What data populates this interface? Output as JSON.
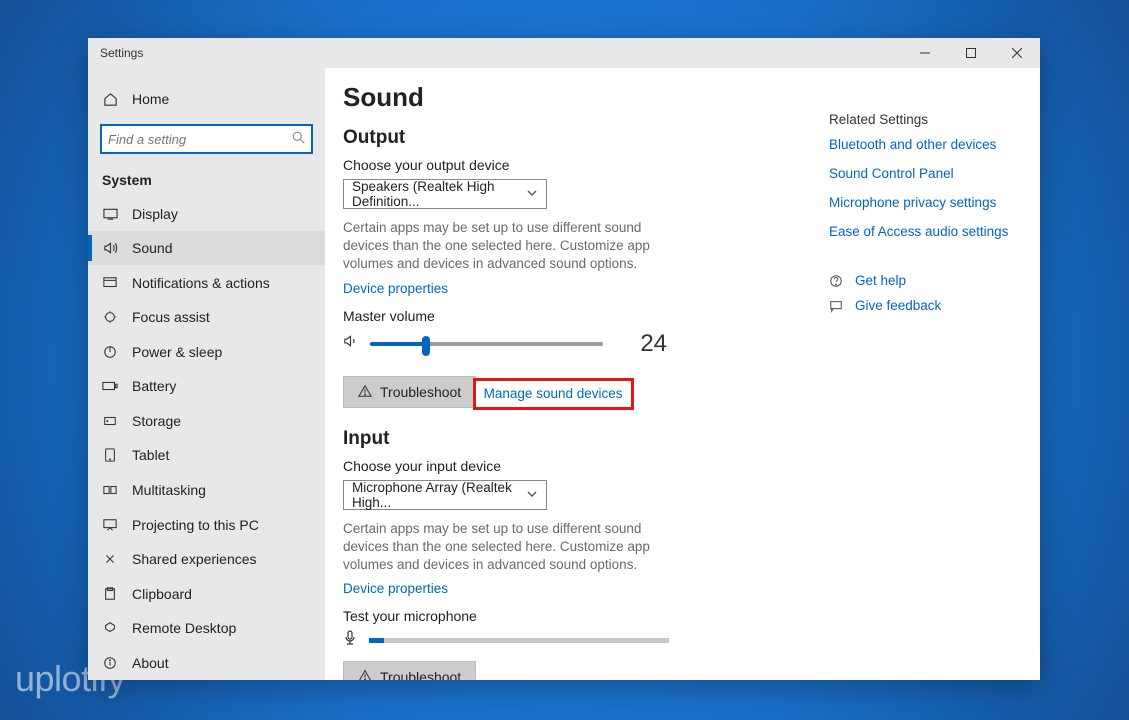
{
  "watermark": "uplotify",
  "window": {
    "title": "Settings"
  },
  "sidebar": {
    "home": "Home",
    "search_placeholder": "Find a setting",
    "heading": "System",
    "items": [
      {
        "label": "Display"
      },
      {
        "label": "Sound"
      },
      {
        "label": "Notifications & actions"
      },
      {
        "label": "Focus assist"
      },
      {
        "label": "Power & sleep"
      },
      {
        "label": "Battery"
      },
      {
        "label": "Storage"
      },
      {
        "label": "Tablet"
      },
      {
        "label": "Multitasking"
      },
      {
        "label": "Projecting to this PC"
      },
      {
        "label": "Shared experiences"
      },
      {
        "label": "Clipboard"
      },
      {
        "label": "Remote Desktop"
      },
      {
        "label": "About"
      }
    ]
  },
  "main": {
    "title": "Sound",
    "output": {
      "heading": "Output",
      "choose_label": "Choose your output device",
      "selected": "Speakers (Realtek High Definition...",
      "desc": "Certain apps may be set up to use different sound devices than the one selected here. Customize app volumes and devices in advanced sound options.",
      "device_properties": "Device properties",
      "master_volume_label": "Master volume",
      "volume": 24,
      "troubleshoot": "Troubleshoot",
      "manage": "Manage sound devices"
    },
    "input": {
      "heading": "Input",
      "choose_label": "Choose your input device",
      "selected": "Microphone Array (Realtek High...",
      "desc": "Certain apps may be set up to use different sound devices than the one selected here. Customize app volumes and devices in advanced sound options.",
      "device_properties": "Device properties",
      "test_label": "Test your microphone",
      "level": 5,
      "troubleshoot": "Troubleshoot"
    }
  },
  "rightrail": {
    "heading": "Related Settings",
    "links": [
      "Bluetooth and other devices",
      "Sound Control Panel",
      "Microphone privacy settings",
      "Ease of Access audio settings"
    ],
    "help": "Get help",
    "feedback": "Give feedback"
  }
}
